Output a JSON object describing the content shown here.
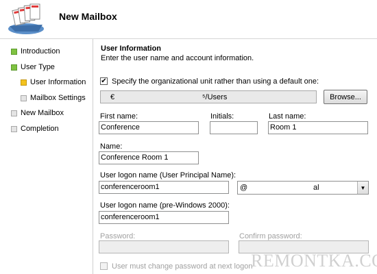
{
  "header": {
    "title": "New Mailbox"
  },
  "nav": [
    {
      "label": "Introduction",
      "state": "green"
    },
    {
      "label": "User Type",
      "state": "green"
    },
    {
      "label": "User Information",
      "state": "yellow"
    },
    {
      "label": "Mailbox Settings",
      "state": "gray"
    },
    {
      "label": "New Mailbox",
      "state": "gray"
    },
    {
      "label": "Completion",
      "state": "gray"
    }
  ],
  "section": {
    "title": "User Information",
    "description": "Enter the user name and account information."
  },
  "ou": {
    "checkbox_label": "Specify the organizational unit rather than using a default one:",
    "checked": true,
    "value_prefix": "€",
    "value": "⁵/Users",
    "browse_label": "Browse..."
  },
  "fields": {
    "first_name_label": "First name:",
    "first_name": "Conference",
    "initials_label": "Initials:",
    "initials": "",
    "last_name_label": "Last name:",
    "last_name": "Room 1",
    "name_label": "Name:",
    "name": "Conference Room 1",
    "upn_label": "User logon name (User Principal Name):",
    "upn": "conferenceroom1",
    "domain_at": "@",
    "domain_suffix": "al",
    "pre2000_label": "User logon name (pre-Windows 2000):",
    "pre2000": "conferenceroom1",
    "password_label": "Password:",
    "confirm_password_label": "Confirm password:",
    "must_change_label": "User must change password at next logon"
  },
  "watermark": "REMONTKA.COM",
  "colors": {
    "step_complete": "#7fc241",
    "step_current": "#f3c21e",
    "step_pending": "#e4e4e4"
  }
}
